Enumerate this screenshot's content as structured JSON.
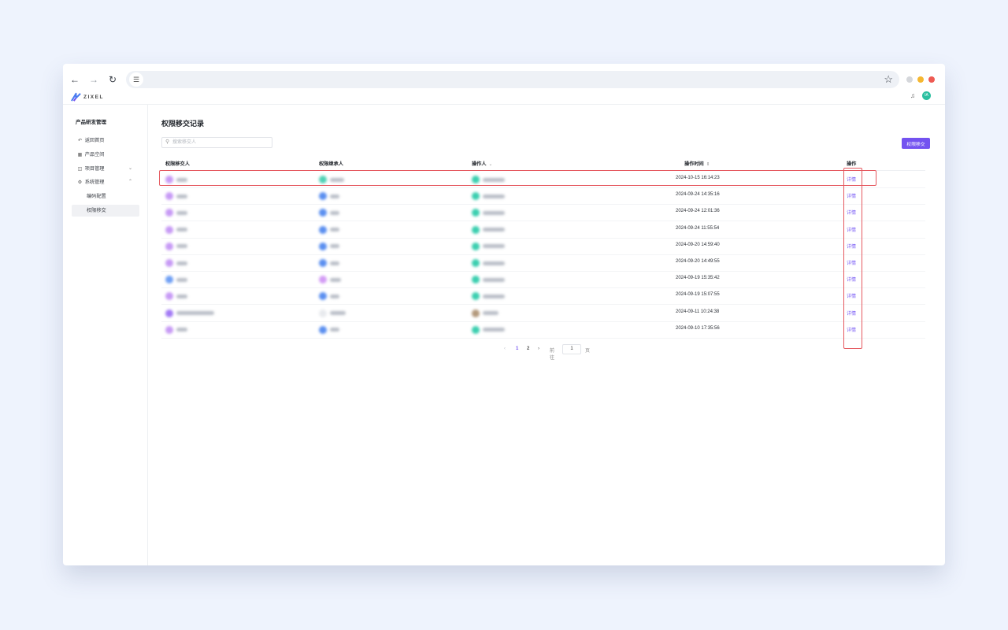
{
  "browser": {
    "back_icon": "arrow-left-icon",
    "forward_icon": "arrow-right-icon",
    "reload_icon": "reload-icon",
    "star_icon": "star-icon",
    "site_settings_icon": "tune-icon"
  },
  "app": {
    "brand": "ZIXEL",
    "avatar_text": "IA"
  },
  "sidebar": {
    "title": "产品研发管理",
    "items": [
      {
        "label": "返回首页",
        "icon": "return-icon"
      },
      {
        "label": "产品空间",
        "icon": "grid-icon"
      },
      {
        "label": "项目管理",
        "icon": "apps-icon",
        "chevron": "chevron-down"
      },
      {
        "label": "系统管理",
        "icon": "gear-icon",
        "chevron": "chevron-up"
      }
    ],
    "sub_items": [
      {
        "label": "编码配置"
      },
      {
        "label": "权限移交",
        "active": true
      }
    ]
  },
  "main": {
    "title": "权限移交记录",
    "search_placeholder": "搜索移交人",
    "primary_button": "权限移交",
    "columns": [
      "权限移交人",
      "权限继承人",
      "操作人",
      "操作时间",
      "操作"
    ],
    "rows": [
      {
        "time": "2024-10-15 16:14:23",
        "action": "详情"
      },
      {
        "time": "2024-09-24 14:35:16",
        "action": "详情"
      },
      {
        "time": "2024-09-24 12:01:36",
        "action": "详情"
      },
      {
        "time": "2024-09-24 11:55:54",
        "action": "详情"
      },
      {
        "time": "2024-09-20 14:59:40",
        "action": "详情"
      },
      {
        "time": "2024-09-20 14:49:55",
        "action": "详情"
      },
      {
        "time": "2024-09-19 15:35:42",
        "action": "详情"
      },
      {
        "time": "2024-09-19 15:07:55",
        "action": "详情"
      },
      {
        "time": "2024-09-11 10:24:38",
        "action": "详情"
      },
      {
        "time": "2024-09-10 17:35:56",
        "action": "详情"
      }
    ],
    "pagination": {
      "pages": [
        "1",
        "2"
      ],
      "current": "1",
      "goto_label": "前往",
      "goto_value": "1",
      "page_suffix": "页"
    }
  },
  "colors": {
    "accent": "#7352f0",
    "link": "#7a5cf5",
    "highlight": "#e5585f"
  }
}
